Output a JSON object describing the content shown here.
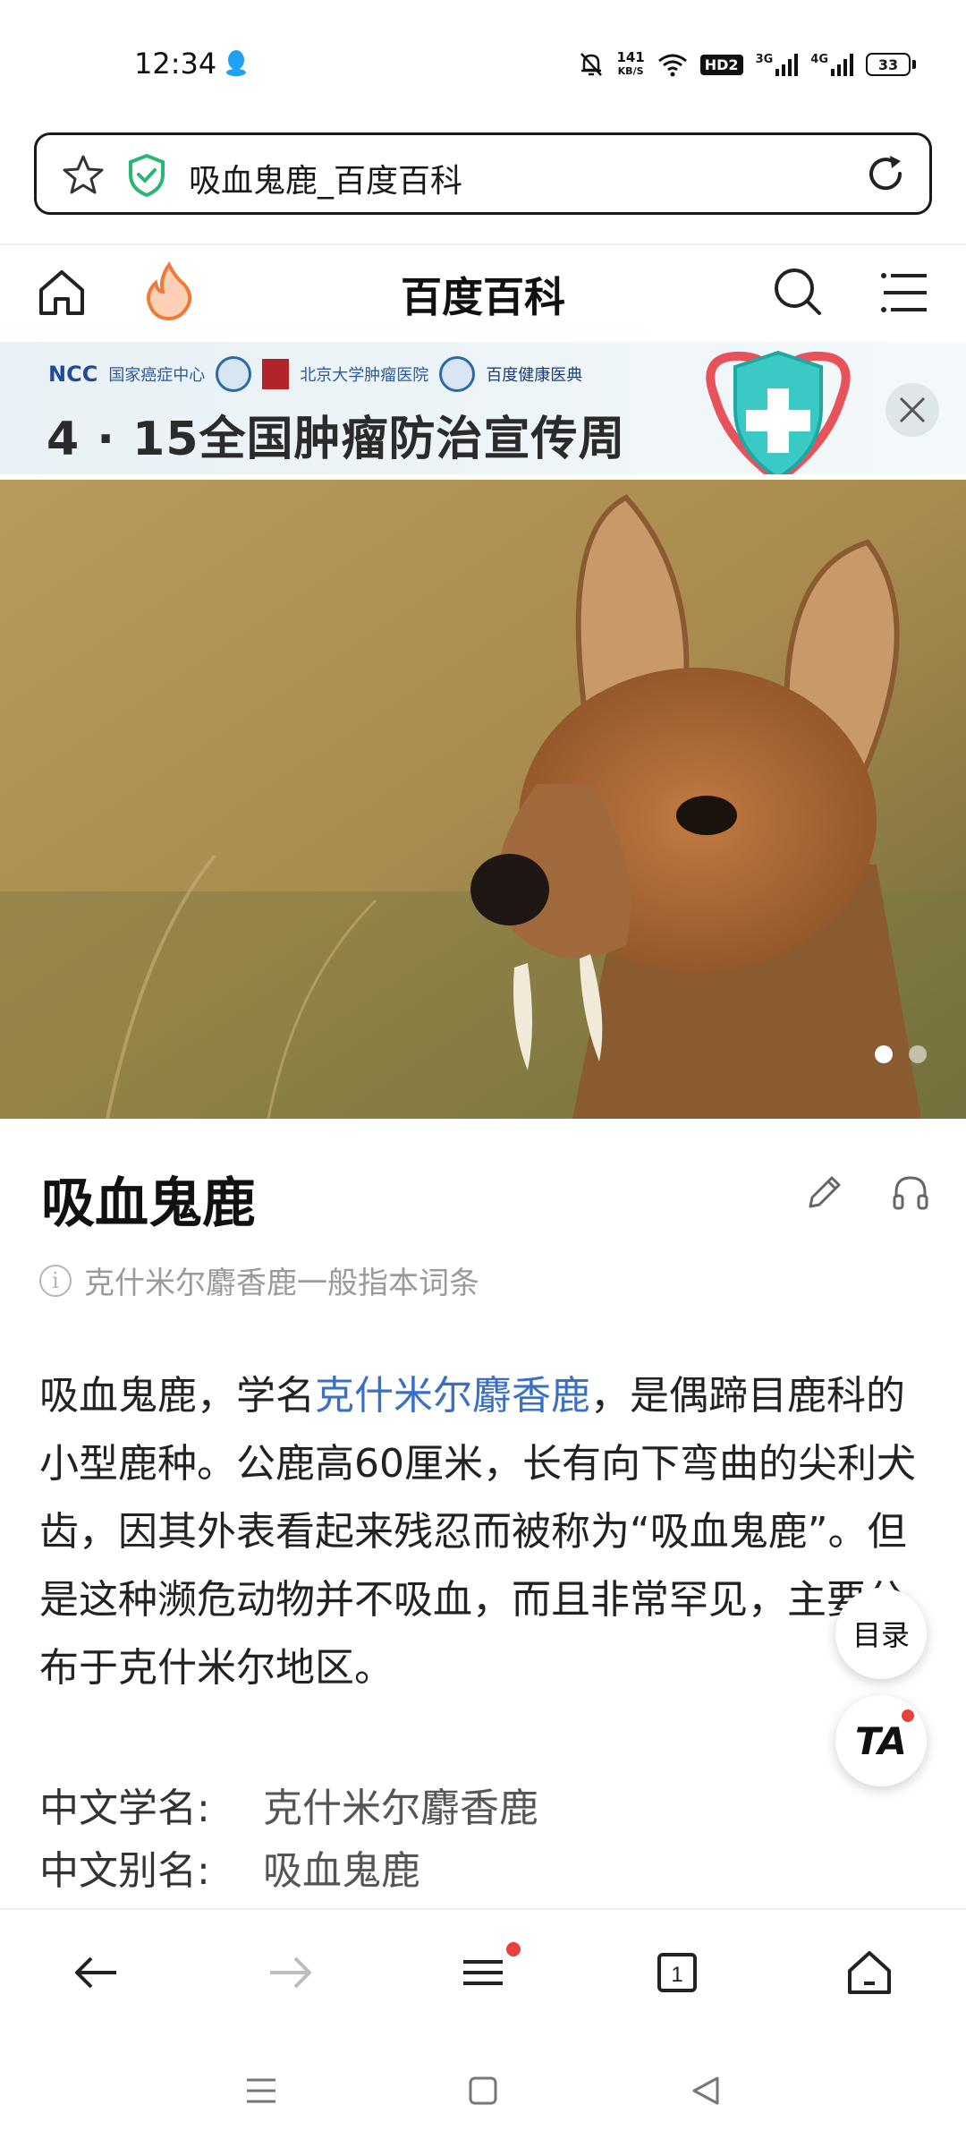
{
  "status_bar": {
    "time": "12:34",
    "net_speed_value": "141",
    "net_speed_unit": "KB/S",
    "hd_label": "HD2",
    "sim1_label": "3G",
    "sim2_label": "4G",
    "battery_level": "33"
  },
  "address_bar": {
    "page_title": "吸血鬼鹿_百度百科"
  },
  "site_header": {
    "title": "百度百科"
  },
  "banner": {
    "logo_ncc": "NCC",
    "logo_ncc_text": "国家癌症中心",
    "logo_pku_text": "北京大学肿瘤医院",
    "logo_baidu_text": "百度健康医典",
    "headline": "4 · 15全国肿瘤防治宣传周"
  },
  "hero": {
    "total_slides": 2,
    "active_slide": 1
  },
  "article": {
    "title": "吸血鬼鹿",
    "disambiguation": "克什米尔麝香鹿一般指本词条",
    "summary_part1": "吸血鬼鹿，学名",
    "summary_link": "克什米尔麝香鹿",
    "summary_part2": "，是偶蹄目鹿科的小型鹿种。公鹿高60厘米，长有向下弯曲的尖利犬齿，因其外表看起来残忍而被称为“吸血鬼鹿”。但是这种濒危动物并不吸血，而且非常罕见，主要分布于克什米尔地区。",
    "info": [
      {
        "key": "中文学名:",
        "value": "克什米尔麝香鹿"
      },
      {
        "key": "中文别名:",
        "value": "吸血鬼鹿"
      }
    ]
  },
  "floating": {
    "toc_label": "目录",
    "ta_label": "TA"
  },
  "colors": {
    "link": "#3a6fc4",
    "notification_dot": "#e8403a",
    "shield_green": "#2bb673",
    "flame_orange": "#f07a3a"
  }
}
